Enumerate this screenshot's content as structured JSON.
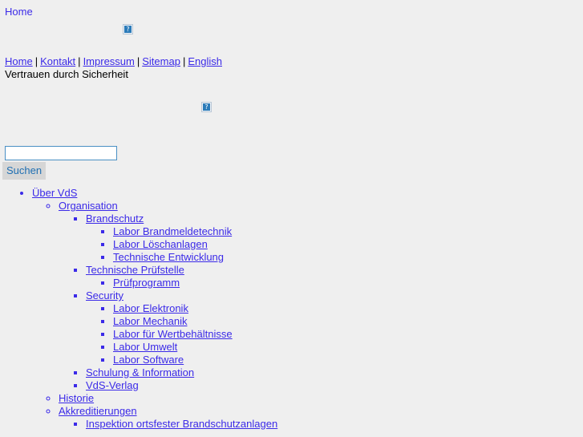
{
  "top_link": {
    "label": "Home"
  },
  "images": [
    {
      "name": "header-banner-image",
      "alt": "?"
    },
    {
      "name": "secondary-banner-image",
      "alt": "?"
    }
  ],
  "meta_nav": {
    "separator": "|",
    "items": [
      {
        "label": "Home"
      },
      {
        "label": "Kontakt"
      },
      {
        "label": "Impressum"
      },
      {
        "label": "Sitemap"
      },
      {
        "label": "English"
      }
    ]
  },
  "tagline": "Vertrauen durch Sicherheit",
  "search": {
    "value": "",
    "placeholder": "",
    "button_label": "Suchen"
  },
  "colors": {
    "background": "#efefef",
    "link": "#3b2ae8",
    "input_border": "#4a90c4",
    "button_background": "#d6d6d6",
    "button_text": "#1f6fb2",
    "text": "#000000"
  },
  "nav_tree": [
    {
      "label": "Über VdS",
      "children": [
        {
          "label": "Organisation",
          "children": [
            {
              "label": "Brandschutz",
              "children": [
                {
                  "label": "Labor Brandmeldetechnik"
                },
                {
                  "label": "Labor Löschanlagen"
                },
                {
                  "label": "Technische Entwicklung"
                }
              ]
            },
            {
              "label": "Technische Prüfstelle",
              "children": [
                {
                  "label": "Prüfprogramm"
                }
              ]
            },
            {
              "label": "Security",
              "children": [
                {
                  "label": "Labor Elektronik"
                },
                {
                  "label": "Labor Mechanik"
                },
                {
                  "label": "Labor für Wertbehältnisse"
                },
                {
                  "label": "Labor Umwelt"
                },
                {
                  "label": "Labor Software"
                }
              ]
            },
            {
              "label": "Schulung & Information"
            },
            {
              "label": "VdS-Verlag"
            }
          ]
        },
        {
          "label": "Historie"
        },
        {
          "label": "Akkreditierungen",
          "children": [
            {
              "label": "Inspektion ortsfester Brandschutzanlagen"
            }
          ]
        }
      ]
    }
  ]
}
